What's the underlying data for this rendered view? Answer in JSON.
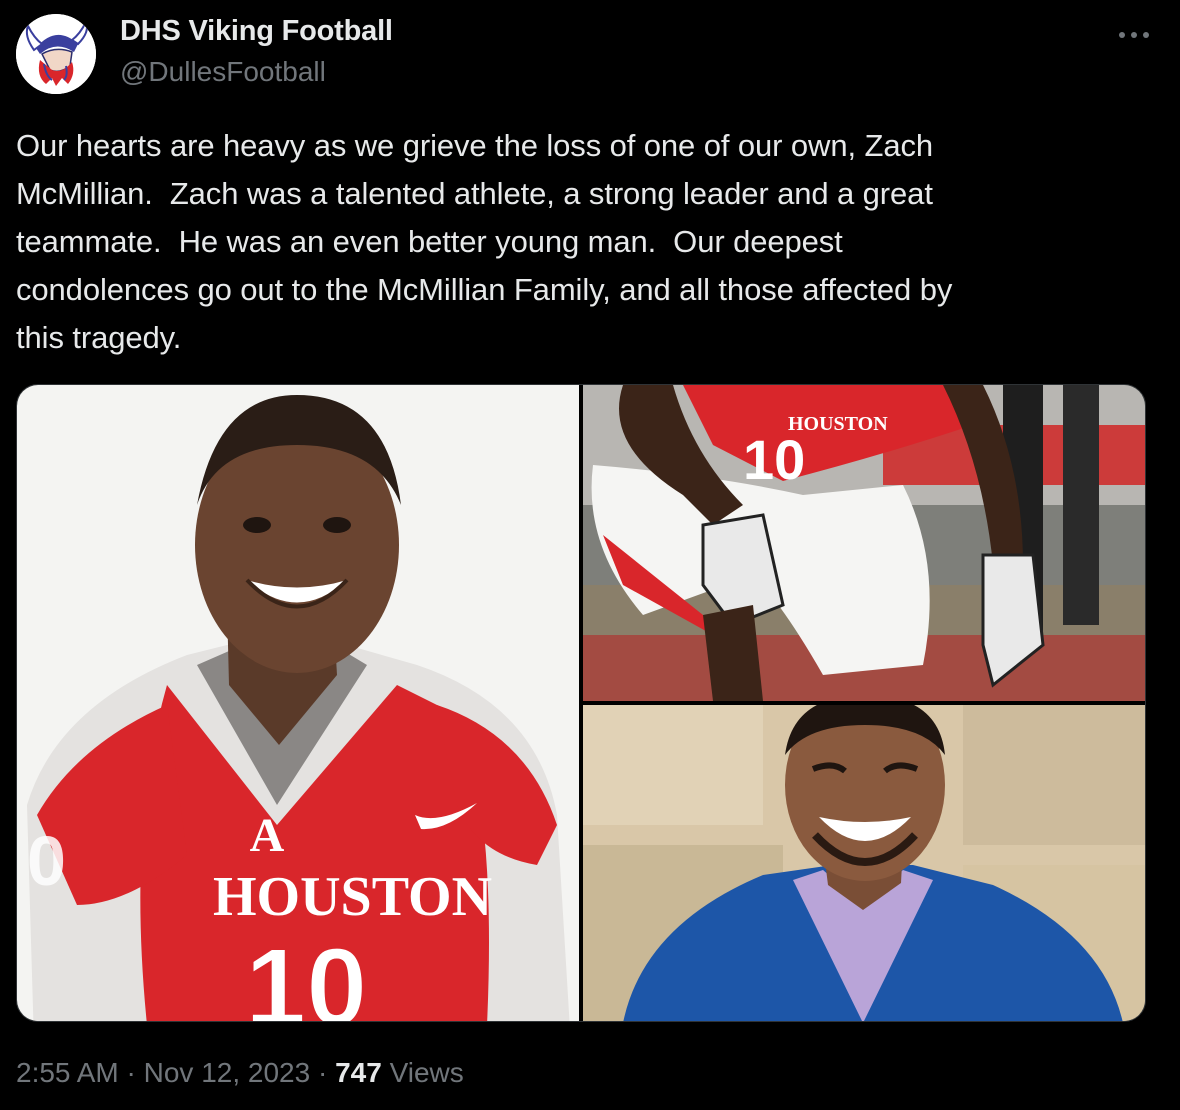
{
  "author": {
    "display_name": "DHS Viking Football",
    "handle": "@DullesFootball",
    "avatar_icon": "viking-logo-icon"
  },
  "more_icon": "more-options-icon",
  "tweet": {
    "lines": [
      "Our hearts are heavy as we grieve the loss of one of our own, Zach",
      "McMillian.  Zach was a talented athlete, a strong leader and a great",
      "teammate.  He was an even better young man.  Our deepest",
      "condolences go out to the McMillian Family, and all those affected by",
      "this tragedy."
    ]
  },
  "media": {
    "photo1": {
      "jersey_text": "HOUSTON",
      "jersey_number": "10"
    },
    "photo2": {
      "jersey_text": "HOUSTON",
      "jersey_number": "10"
    }
  },
  "meta": {
    "time": "2:55 AM",
    "separator": " · ",
    "date": "Nov 12, 2023",
    "views_count": "747",
    "views_label": " Views"
  },
  "colors": {
    "background": "#000000",
    "text_primary": "#e7e9ea",
    "text_secondary": "#71767b",
    "border": "#2f3336",
    "jersey_red": "#d9262b"
  }
}
